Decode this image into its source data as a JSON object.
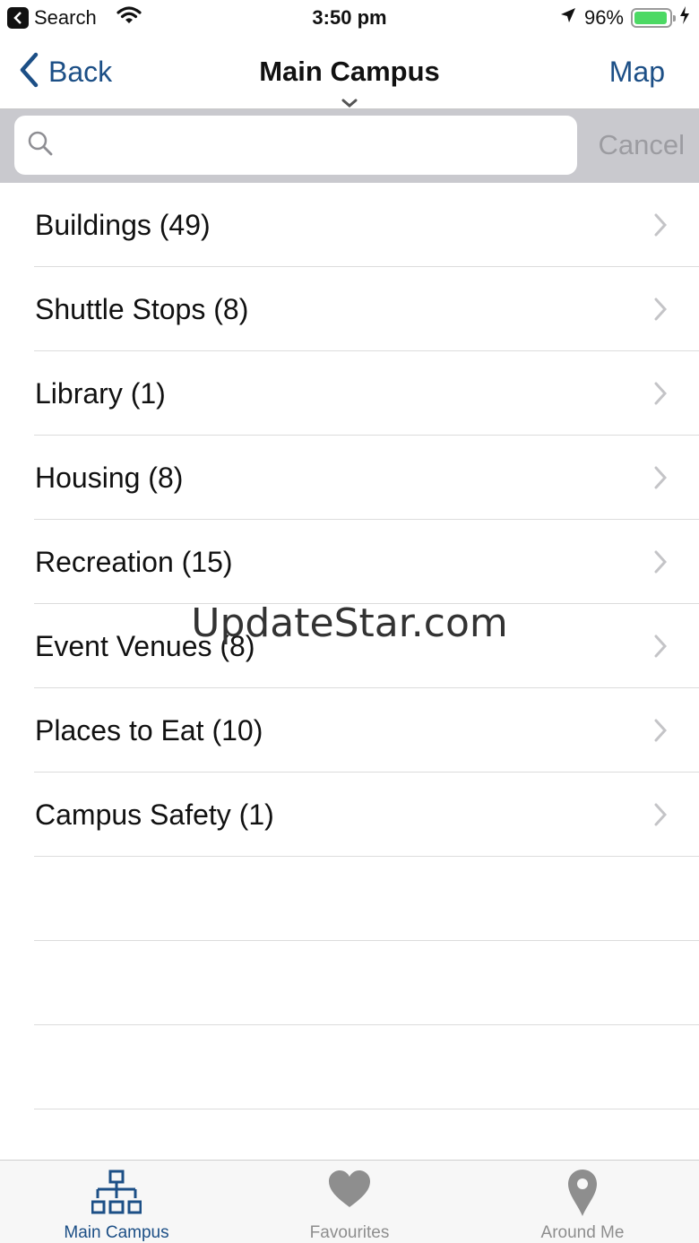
{
  "status_bar": {
    "back_app": "Search",
    "time": "3:50 pm",
    "battery_percent": "96%",
    "battery_level": 0.96,
    "icons": [
      "back-to-app-icon",
      "wifi-icon",
      "location-arrow-icon",
      "battery-icon",
      "charging-bolt-icon"
    ]
  },
  "nav": {
    "back_label": "Back",
    "title": "Main Campus",
    "map_label": "Map"
  },
  "search": {
    "placeholder": "",
    "value": "",
    "cancel_label": "Cancel"
  },
  "list": {
    "items": [
      {
        "label": "Buildings (49)"
      },
      {
        "label": "Shuttle Stops (8)"
      },
      {
        "label": "Library (1)"
      },
      {
        "label": "Housing (8)"
      },
      {
        "label": "Recreation (15)"
      },
      {
        "label": "Event Venues (8)"
      },
      {
        "label": "Places to Eat (10)"
      },
      {
        "label": "Campus Safety (1)"
      }
    ]
  },
  "watermark": "UpdateStar.com",
  "tabs": [
    {
      "label": "Main Campus",
      "icon": "sitemap-icon",
      "active": true
    },
    {
      "label": "Favourites",
      "icon": "heart-icon",
      "active": false
    },
    {
      "label": "Around Me",
      "icon": "map-pin-icon",
      "active": false
    }
  ],
  "colors": {
    "accent": "#1c4f86",
    "inactive_tab": "#8e8e8e",
    "search_bar_bg": "#c9c9ce",
    "battery": "#4cd964"
  }
}
